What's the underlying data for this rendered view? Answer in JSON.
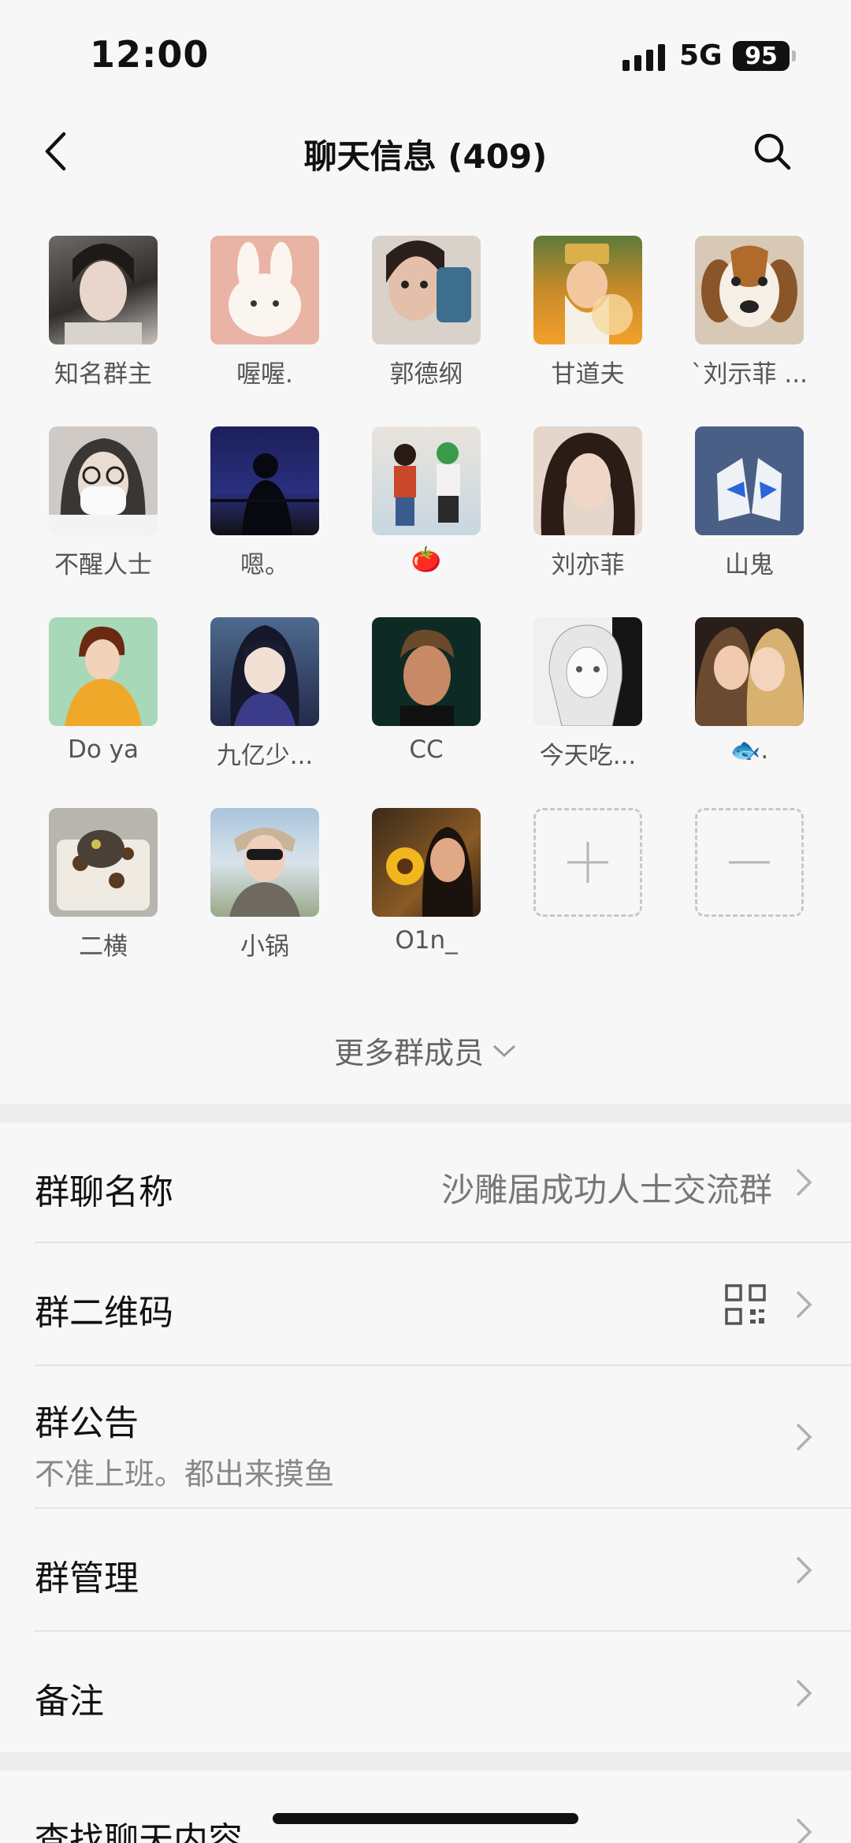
{
  "status": {
    "time": "12:00",
    "network": "5G",
    "battery": "95"
  },
  "nav": {
    "title": "聊天信息 (409)"
  },
  "members": [
    {
      "name": "知名群主"
    },
    {
      "name": "喔喔."
    },
    {
      "name": "郭德纲"
    },
    {
      "name": "甘道夫"
    },
    {
      "name": "`刘示菲 ..."
    },
    {
      "name": "不醒人士"
    },
    {
      "name": "嗯。"
    },
    {
      "name": "🍅"
    },
    {
      "name": "刘亦菲"
    },
    {
      "name": "山鬼"
    },
    {
      "name": "Do ya"
    },
    {
      "name": "九亿少..."
    },
    {
      "name": "CC"
    },
    {
      "name": "今天吃..."
    },
    {
      "name": "🐟."
    },
    {
      "name": "二横"
    },
    {
      "name": "小锅"
    },
    {
      "name": "O1n_"
    }
  ],
  "more_members": "更多群成员",
  "settings": {
    "group_name": {
      "label": "群聊名称",
      "value": "沙雕届成功人士交流群"
    },
    "qr_code": {
      "label": "群二维码"
    },
    "announcement": {
      "label": "群公告",
      "text": "不准上班。都出来摸鱼"
    },
    "manage": {
      "label": "群管理"
    },
    "remark": {
      "label": "备注"
    },
    "search_history": {
      "label": "查找聊天内容"
    }
  }
}
